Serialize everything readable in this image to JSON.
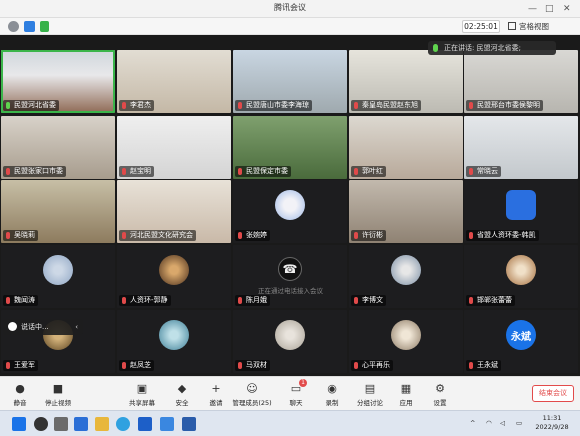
{
  "window": {
    "title": "腾讯会议"
  },
  "status": {
    "timer": "02:25:01",
    "view_label": "宫格视图"
  },
  "speaking": {
    "text": "正在讲话: 民盟河北省委;"
  },
  "tiles": [
    {
      "name": "民盟河北省委",
      "active": true
    },
    {
      "name": "李君杰"
    },
    {
      "name": "民盟唐山市委李海琼"
    },
    {
      "name": "秦皇岛民盟赵东旭"
    },
    {
      "name": "民盟邢台市委侯黎明"
    },
    {
      "name": "民盟张家口市委"
    },
    {
      "name": "赵宝明"
    },
    {
      "name": "民盟保定市委"
    },
    {
      "name": "郭叶红"
    },
    {
      "name": "常晓云"
    },
    {
      "name": "吴晓莉"
    },
    {
      "name": "河北民盟文化研究会"
    },
    {
      "name": "张婉婷",
      "hint": ""
    },
    {
      "name": "许衍彬"
    },
    {
      "name": "省盟人资环委-韩凯"
    },
    {
      "name": "魏闻涛"
    },
    {
      "name": "人资环-郭静"
    },
    {
      "name": "陈月娥",
      "hint": "正在通过电话接入会议"
    },
    {
      "name": "李博文"
    },
    {
      "name": "邯郸张蕾蕾"
    },
    {
      "name": "王爱军"
    },
    {
      "name": "赵凤芝"
    },
    {
      "name": "马双材"
    },
    {
      "name": "心平再乐"
    },
    {
      "name": "王永斌",
      "avatar_text": "永斌"
    }
  ],
  "overlay": {
    "chip_text": "说话中..."
  },
  "toolbar": {
    "items": [
      {
        "label": "静音",
        "icon": "mic-icon"
      },
      {
        "label": "停止视频",
        "icon": "camera-icon"
      },
      {
        "label": "共享屏幕",
        "icon": "share-screen-icon"
      },
      {
        "label": "安全",
        "icon": "shield-icon"
      },
      {
        "label": "邀请",
        "icon": "invite-icon"
      },
      {
        "label": "管理成员(25)",
        "icon": "members-icon"
      },
      {
        "label": "聊天",
        "icon": "chat-icon",
        "badge": "1"
      },
      {
        "label": "录制",
        "icon": "record-icon"
      },
      {
        "label": "分组讨论",
        "icon": "breakout-icon"
      },
      {
        "label": "应用",
        "icon": "apps-icon"
      },
      {
        "label": "设置",
        "icon": "gear-icon"
      }
    ],
    "end_label": "结束会议"
  },
  "taskbar": {
    "time": "11:31",
    "date": "2022/9/28"
  },
  "colors": {
    "accent_green": "#3bb54a",
    "end_red": "#e24b4b",
    "tencent_blue": "#1a73e8"
  }
}
